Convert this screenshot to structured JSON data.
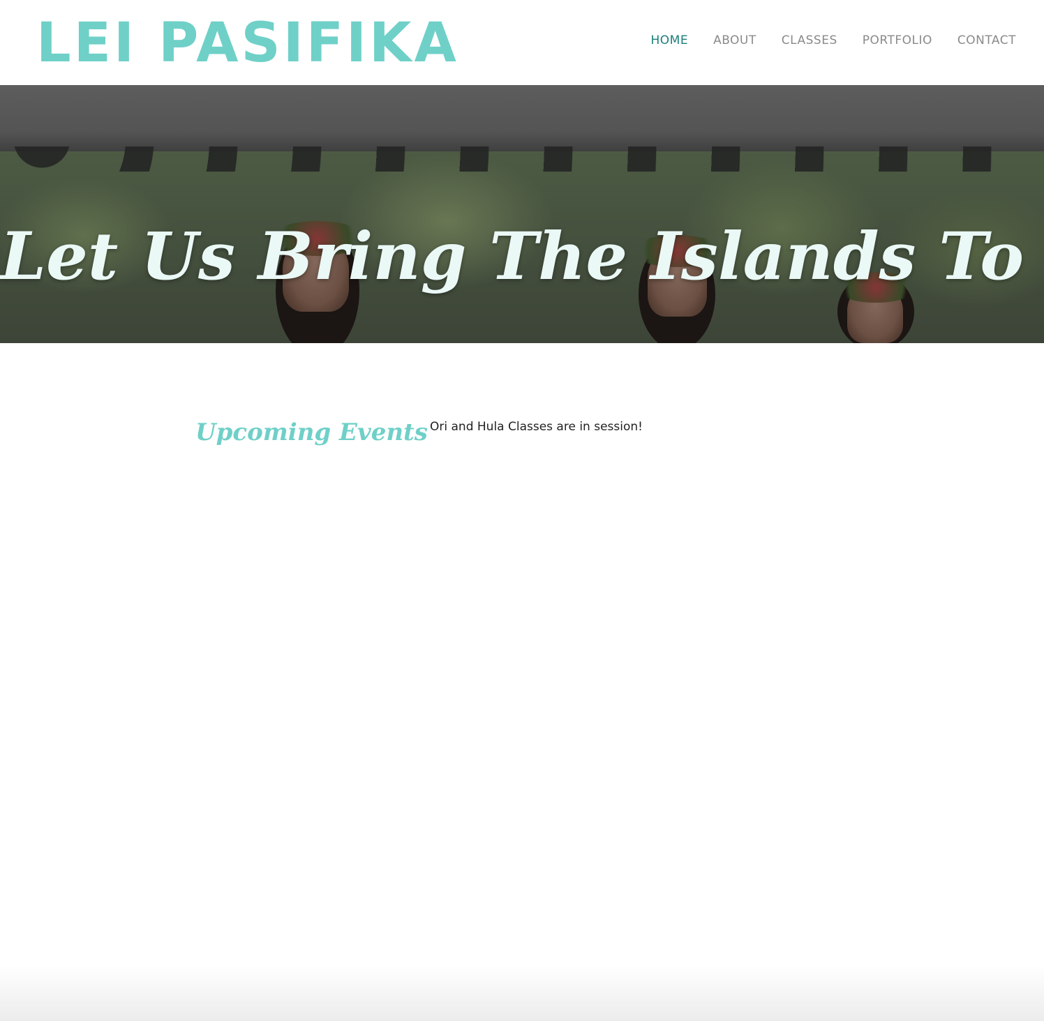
{
  "header": {
    "logo_text": "LEI PASIFIKA",
    "nav": [
      {
        "label": "HOME",
        "active": true
      },
      {
        "label": "ABOUT",
        "active": false
      },
      {
        "label": "CLASSES",
        "active": false
      },
      {
        "label": "PORTFOLIO",
        "active": false
      },
      {
        "label": "CONTACT",
        "active": false
      }
    ]
  },
  "hero": {
    "title": "Let Us Bring The Islands To You.",
    "image_subject": "dancers-performing-under-tent"
  },
  "events": {
    "heading": "Upcoming Events",
    "text": "Ori and Hula Classes are in session!"
  },
  "colors": {
    "brand": "#6fd0c8",
    "nav_active": "#1a7e7a",
    "nav_inactive": "#8a8a8a",
    "hero_text": "#eaf8f6",
    "body_text": "#222222"
  }
}
